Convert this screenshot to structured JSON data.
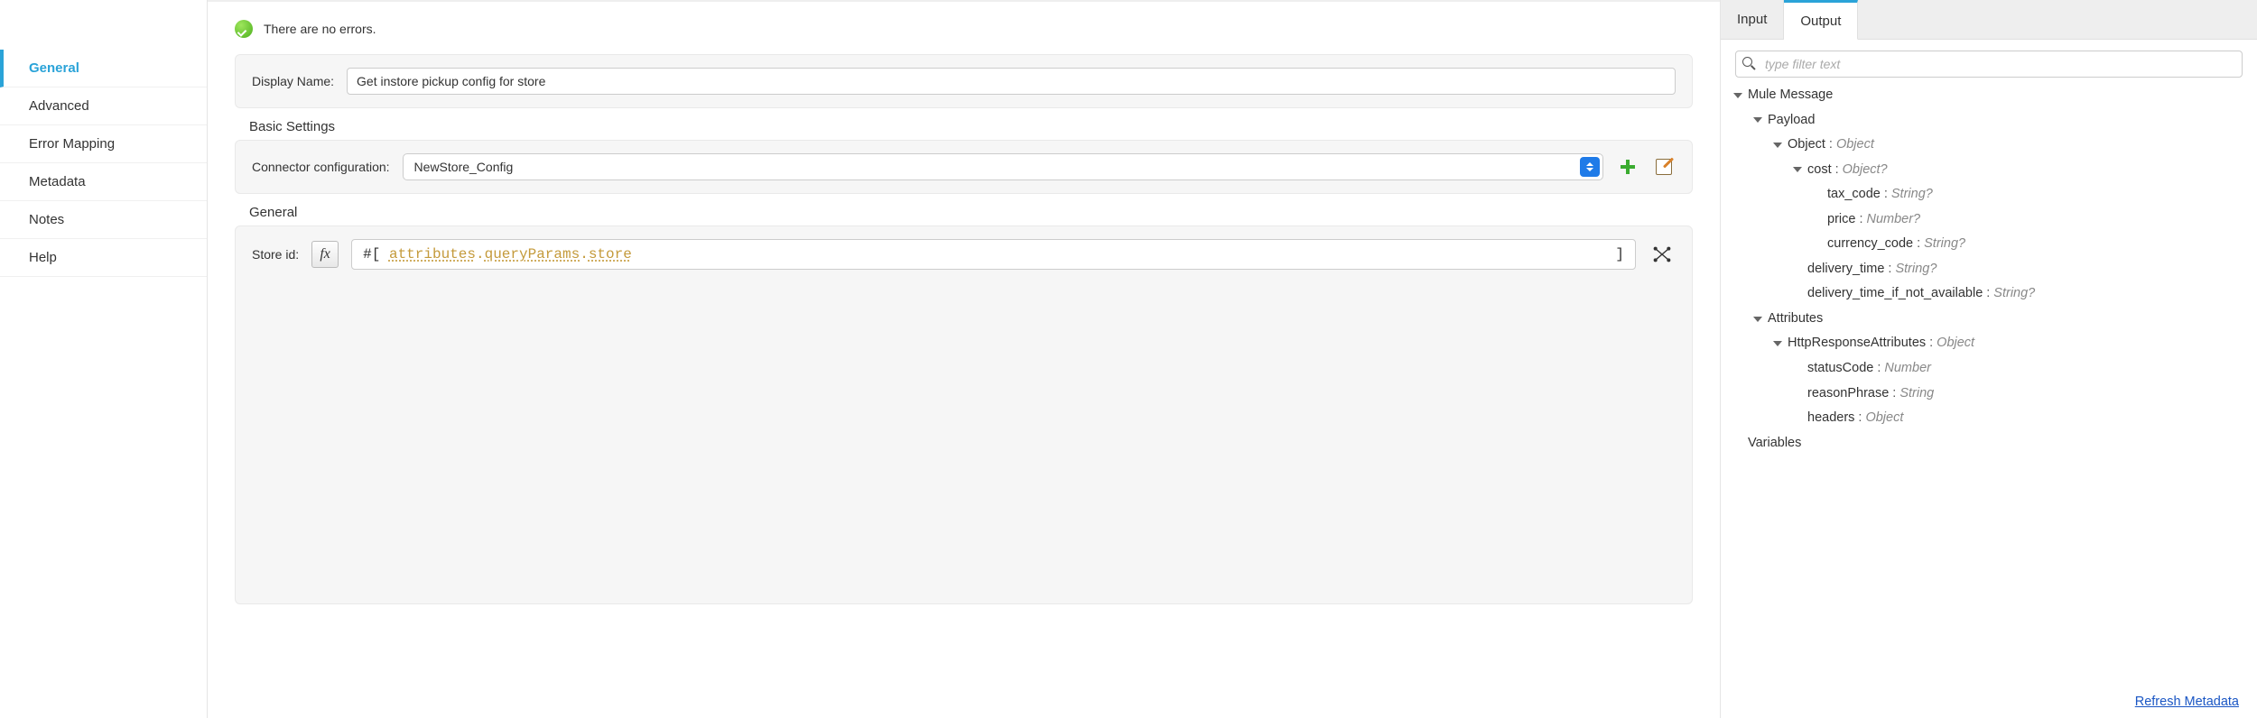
{
  "leftNav": {
    "items": [
      {
        "label": "General",
        "active": true
      },
      {
        "label": "Advanced",
        "active": false
      },
      {
        "label": "Error Mapping",
        "active": false
      },
      {
        "label": "Metadata",
        "active": false
      },
      {
        "label": "Notes",
        "active": false
      },
      {
        "label": "Help",
        "active": false
      }
    ]
  },
  "status": {
    "text": "There are no errors."
  },
  "displayName": {
    "label": "Display Name:",
    "value": "Get instore pickup config for store"
  },
  "basic": {
    "heading": "Basic Settings",
    "connectorLabel": "Connector configuration:",
    "connectorValue": "NewStore_Config"
  },
  "general": {
    "heading": "General",
    "storeIdLabel": "Store id:",
    "fx": "fx",
    "expr": {
      "hash": "#",
      "open": "[",
      "p1": "attributes",
      "p2": "queryParams",
      "p3": "store",
      "close": "]"
    }
  },
  "rightPanel": {
    "tabs": {
      "input": "Input",
      "output": "Output",
      "active": "output"
    },
    "filterPlaceholder": "type filter text",
    "tree": [
      {
        "depth": 0,
        "caret": "down",
        "name": "Mule Message"
      },
      {
        "depth": 1,
        "caret": "down",
        "name": "Payload"
      },
      {
        "depth": 2,
        "caret": "down",
        "name": "Object",
        "type": "Object"
      },
      {
        "depth": 3,
        "caret": "down",
        "name": "cost",
        "type": "Object?"
      },
      {
        "depth": 4,
        "caret": "none",
        "name": "tax_code",
        "type": "String?"
      },
      {
        "depth": 4,
        "caret": "none",
        "name": "price",
        "type": "Number?"
      },
      {
        "depth": 4,
        "caret": "none",
        "name": "currency_code",
        "type": "String?"
      },
      {
        "depth": 3,
        "caret": "none",
        "name": "delivery_time",
        "type": "String?"
      },
      {
        "depth": 3,
        "caret": "none",
        "name": "delivery_time_if_not_available",
        "type": "String?"
      },
      {
        "depth": 1,
        "caret": "down",
        "name": "Attributes"
      },
      {
        "depth": 2,
        "caret": "down",
        "name": "HttpResponseAttributes",
        "type": "Object"
      },
      {
        "depth": 3,
        "caret": "none",
        "name": "statusCode",
        "type": "Number"
      },
      {
        "depth": 3,
        "caret": "none",
        "name": "reasonPhrase",
        "type": "String"
      },
      {
        "depth": 3,
        "caret": "none",
        "name": "headers",
        "type": "Object"
      },
      {
        "depth": 0,
        "caret": "none",
        "name": "Variables"
      }
    ],
    "refresh": "Refresh Metadata"
  }
}
